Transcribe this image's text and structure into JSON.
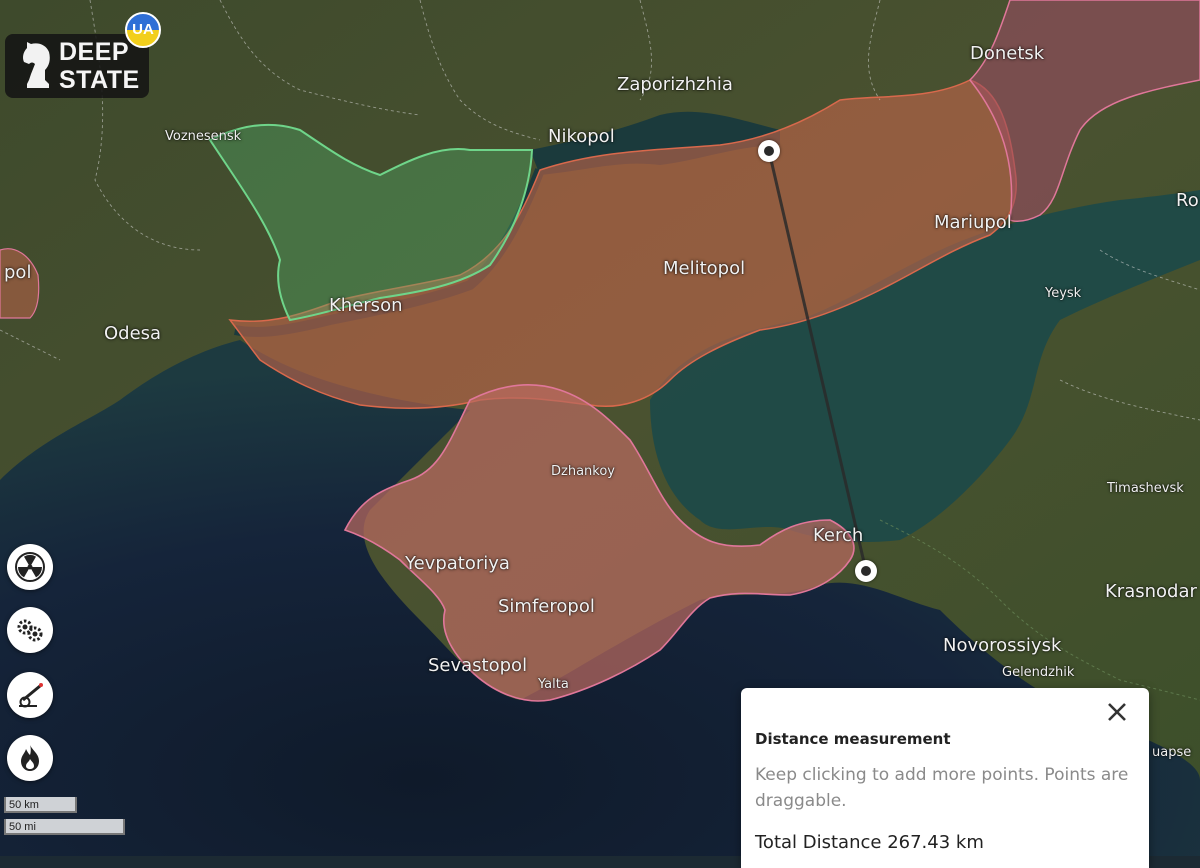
{
  "app": {
    "logo_line1": "DEEP",
    "logo_line2": "STATE",
    "badge": "UA"
  },
  "map": {
    "labels": {
      "zaporizhzhia": "Zaporizhzhia",
      "donetsk": "Donetsk",
      "voznesensk": "Voznesensk",
      "nikopol": "Nikopol",
      "ro": "Ro",
      "mariupol": "Mariupol",
      "melitopol": "Melitopol",
      "pol": "pol",
      "kherson": "Kherson",
      "yeysk": "Yeysk",
      "odesa": "Odesa",
      "dzhankoy": "Dzhankoy",
      "timashevsk": "Timashevsk",
      "kerch": "Kerch",
      "yevpatoriya": "Yevpatoriya",
      "krasnodar": "Krasnodar",
      "simferopol": "Simferopol",
      "novorossiysk": "Novorossiysk",
      "sevastopol": "Sevastopol",
      "gelendzhik": "Gelendzhik",
      "yalta": "Yalta",
      "uapse": "uapse"
    },
    "colors": {
      "occupied": "#c0644a",
      "liberated": "#4fae68",
      "russia_border": "#e0779a"
    }
  },
  "controls": [
    {
      "name": "radiation-icon"
    },
    {
      "name": "gears-icon"
    },
    {
      "name": "artillery-icon"
    },
    {
      "name": "fire-icon"
    }
  ],
  "scale": {
    "km_label": "50 km",
    "mi_label": "50 mi"
  },
  "measurement": {
    "title": "Distance measurement",
    "description": "Keep clicking to add more points. Points are draggable.",
    "total": "Total Distance 267.43 km",
    "close_icon": "close-icon"
  }
}
